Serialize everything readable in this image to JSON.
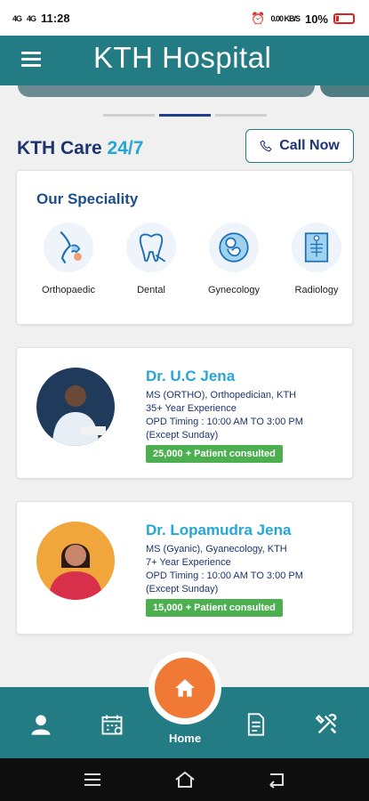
{
  "status_bar": {
    "network_left": "4G",
    "network_left2": "4G",
    "time": "11:28",
    "speed": "0.00 KB/S",
    "battery": "10%"
  },
  "header": {
    "title": "KTH Hospital"
  },
  "care": {
    "title_prefix": "KTH Care",
    "title_accent": "24/7",
    "call_label": "Call Now"
  },
  "speciality": {
    "title": "Our Speciality",
    "items": [
      {
        "label": "Orthopaedic",
        "icon": "bone-joint-icon"
      },
      {
        "label": "Dental",
        "icon": "tooth-icon"
      },
      {
        "label": "Gynecology",
        "icon": "fetus-icon"
      },
      {
        "label": "Radiology",
        "icon": "xray-icon"
      }
    ]
  },
  "doctors": [
    {
      "name": "Dr. U.C Jena",
      "qualification": "MS (ORTHO), Orthopedician, KTH",
      "experience": "35+ Year Experience",
      "timing": "OPD Timing : 10:00 AM TO 3:00 PM",
      "except": "(Except Sunday)",
      "patients": "25,000 + Patient consulted"
    },
    {
      "name": "Dr. Lopamudra Jena",
      "qualification": "MS (Gyanic), Gyanecology, KTH",
      "experience": "7+ Year Experience",
      "timing": "OPD Timing : 10:00 AM TO 3:00 PM",
      "except": "(Except Sunday)",
      "patients": "15,000 + Patient consulted"
    }
  ],
  "nav": {
    "home_label": "Home",
    "items": [
      "user-icon",
      "calendar-icon",
      "home-icon",
      "document-icon",
      "tools-icon"
    ]
  },
  "colors": {
    "brand_teal": "#237b83",
    "accent_blue": "#25a6d8",
    "navy": "#1d3470",
    "home_orange": "#f07a35",
    "badge_green": "#4caf50"
  }
}
